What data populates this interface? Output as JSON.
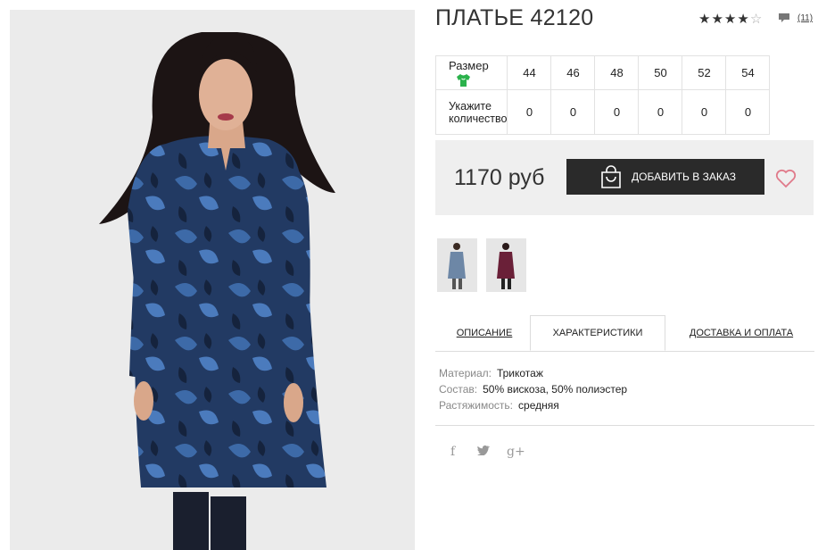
{
  "product": {
    "title": "ПЛАТЬЕ 42120",
    "rating": 4,
    "rating_max": 5,
    "reviews": "(11)"
  },
  "sizes": {
    "row_label": "Размер",
    "qty_label_line1": "Укажите",
    "qty_label_line2": "количество",
    "values": [
      "44",
      "46",
      "48",
      "50",
      "52",
      "54"
    ],
    "quantities": [
      "0",
      "0",
      "0",
      "0",
      "0",
      "0"
    ]
  },
  "buy": {
    "price": "1170 руб",
    "button_label": "ДОБАВИТЬ В ЗАКАЗ"
  },
  "tabs": [
    {
      "label": "ОПИСАНИЕ",
      "active": false
    },
    {
      "label": "ХАРАКТЕРИСТИКИ",
      "active": true
    },
    {
      "label": "ДОСТАВКА И ОПЛАТА",
      "active": false
    }
  ],
  "specs": [
    {
      "key": "Материал:",
      "value": "Трикотаж"
    },
    {
      "key": "Состав:",
      "value": "50% вискоза, 50% полиэстер"
    },
    {
      "key": "Растяжимость:",
      "value": "средняя"
    }
  ],
  "social": [
    "f",
    "t",
    "g+"
  ],
  "colors": {
    "accent_green": "#2bb24c",
    "button_bg": "#2a2a2a",
    "buy_box_bg": "#efefef",
    "heart": "#e07a8a"
  }
}
